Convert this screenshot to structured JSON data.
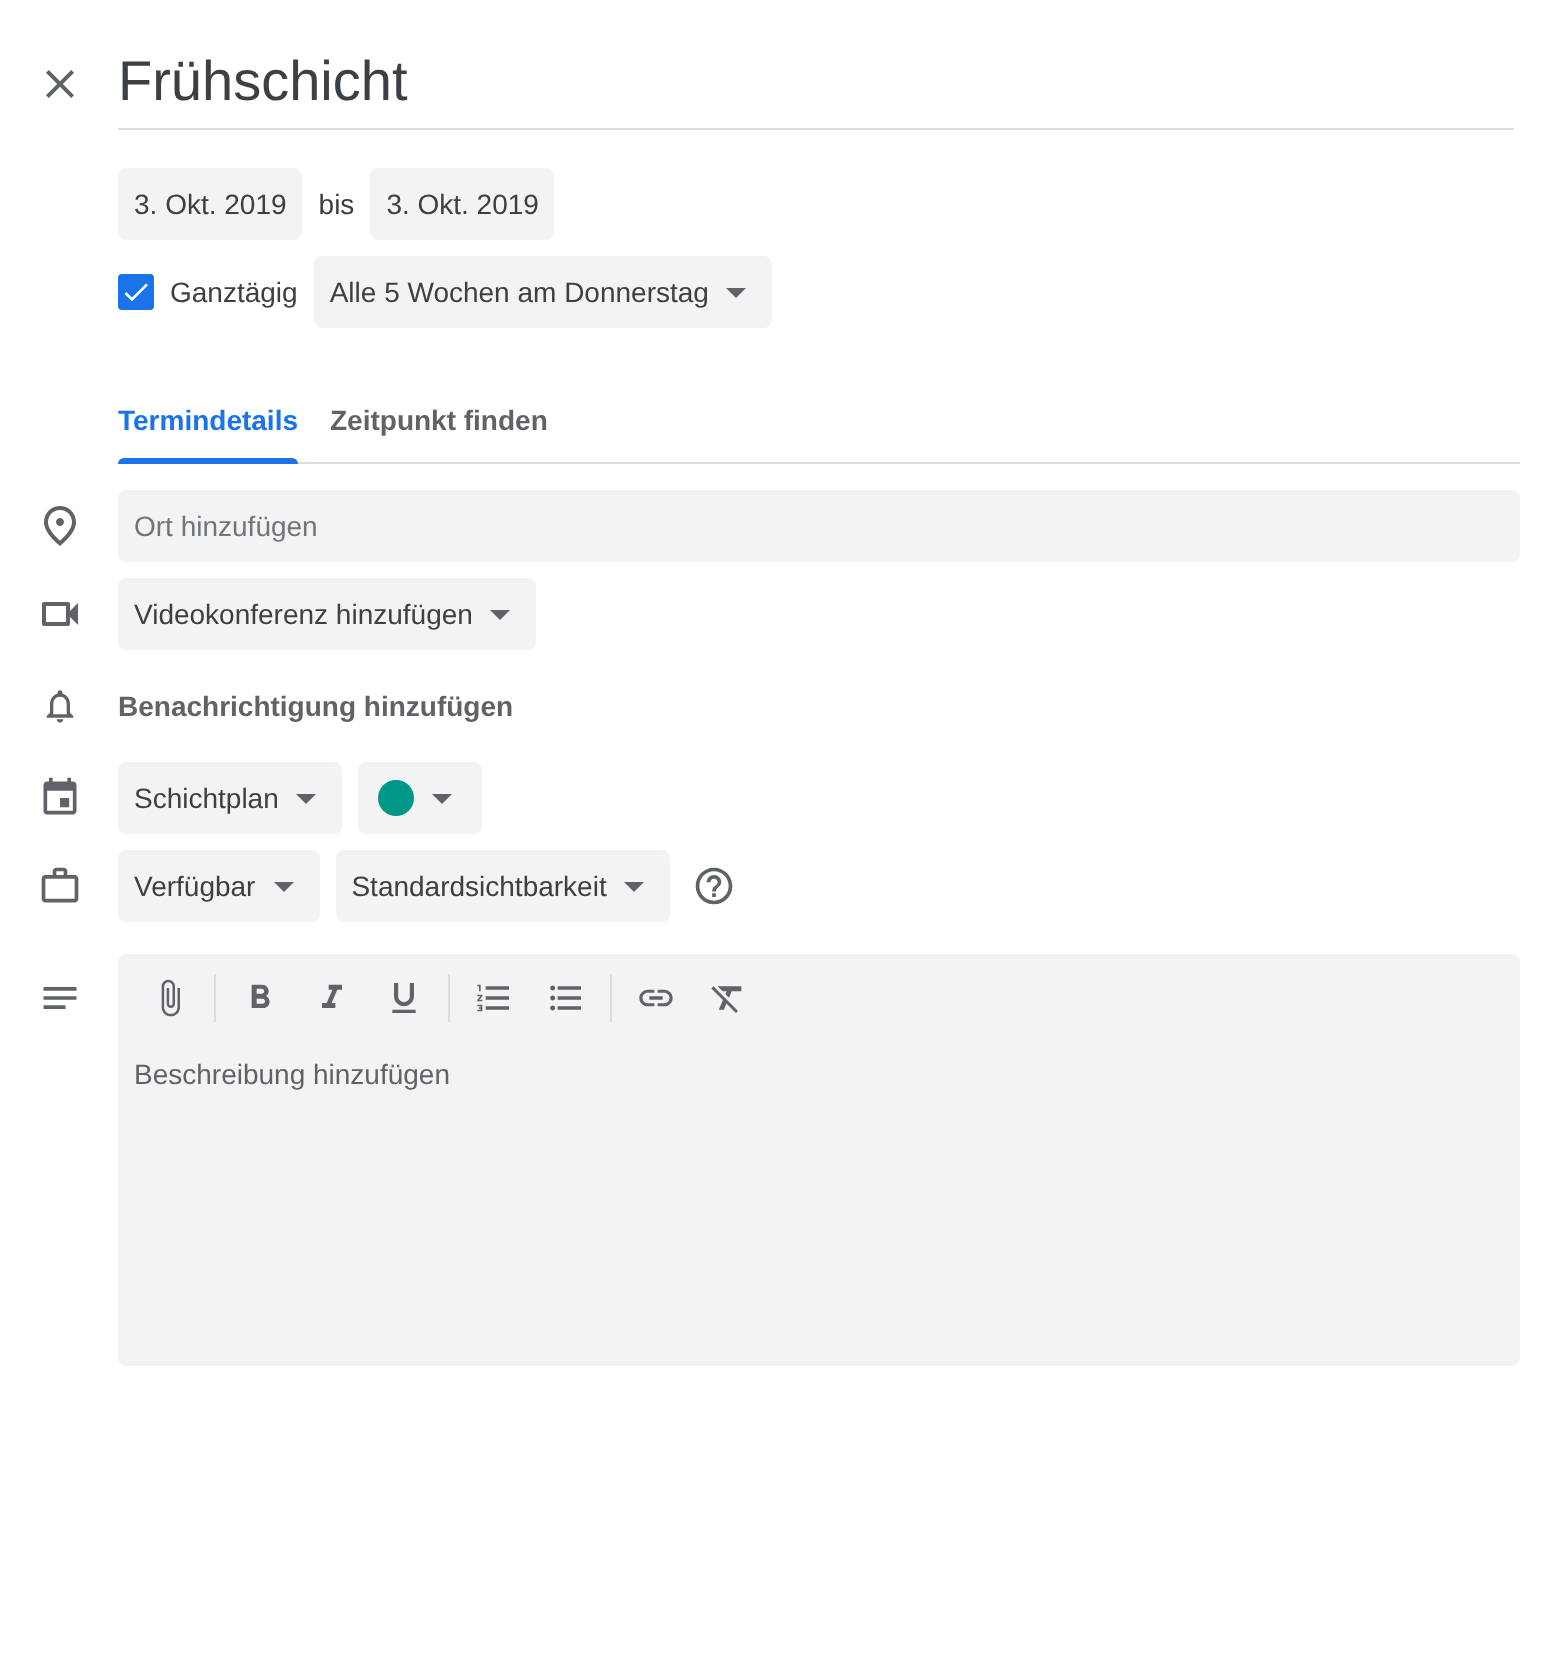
{
  "title": "Frühschicht",
  "dates": {
    "start": "3. Okt. 2019",
    "separator": "bis",
    "end": "3. Okt. 2019"
  },
  "all_day": {
    "label": "Ganztägig",
    "checked": true
  },
  "recurrence": {
    "value": "Alle 5 Wochen am Donnerstag"
  },
  "tabs": [
    {
      "label": "Termindetails",
      "selected": true
    },
    {
      "label": "Zeitpunkt finden",
      "selected": false
    }
  ],
  "location": {
    "placeholder": "Ort hinzufügen"
  },
  "video_conference": {
    "label": "Videokonferenz hinzufügen"
  },
  "notification": {
    "label": "Benachrichtigung hinzufügen"
  },
  "calendar": {
    "value": "Schichtplan",
    "color": "#009688"
  },
  "availability": {
    "value": "Verfügbar"
  },
  "visibility": {
    "value": "Standardsichtbarkeit"
  },
  "description": {
    "placeholder": "Beschreibung hinzufügen"
  }
}
